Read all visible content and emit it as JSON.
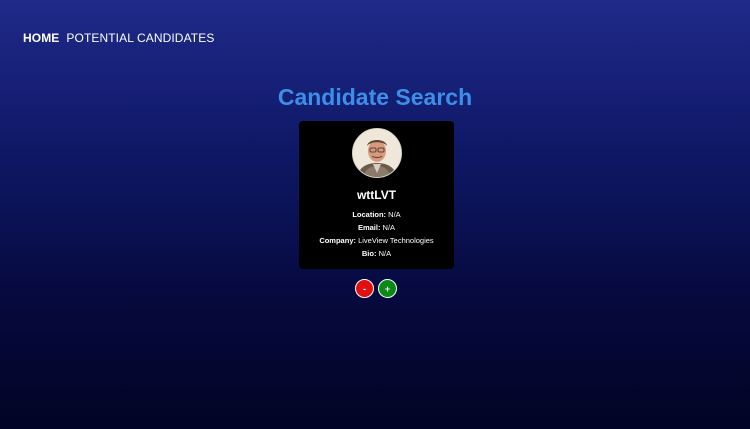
{
  "nav": {
    "home_label": "HOME",
    "potential_label": "POTENTIAL CANDIDATES"
  },
  "page": {
    "title": "Candidate Search"
  },
  "candidate": {
    "username": "wttLVT",
    "location_label": "Location:",
    "location_value": "N/A",
    "email_label": "Email:",
    "email_value": "N/A",
    "company_label": "Company:",
    "company_value": "LiveView Technologies",
    "bio_label": "Bio:",
    "bio_value": "N/A"
  },
  "actions": {
    "reject_label": "-",
    "accept_label": "+"
  },
  "colors": {
    "title": "#3d8ee8",
    "card": "#000000",
    "reject": "#e01010",
    "accept": "#0a8a14"
  }
}
